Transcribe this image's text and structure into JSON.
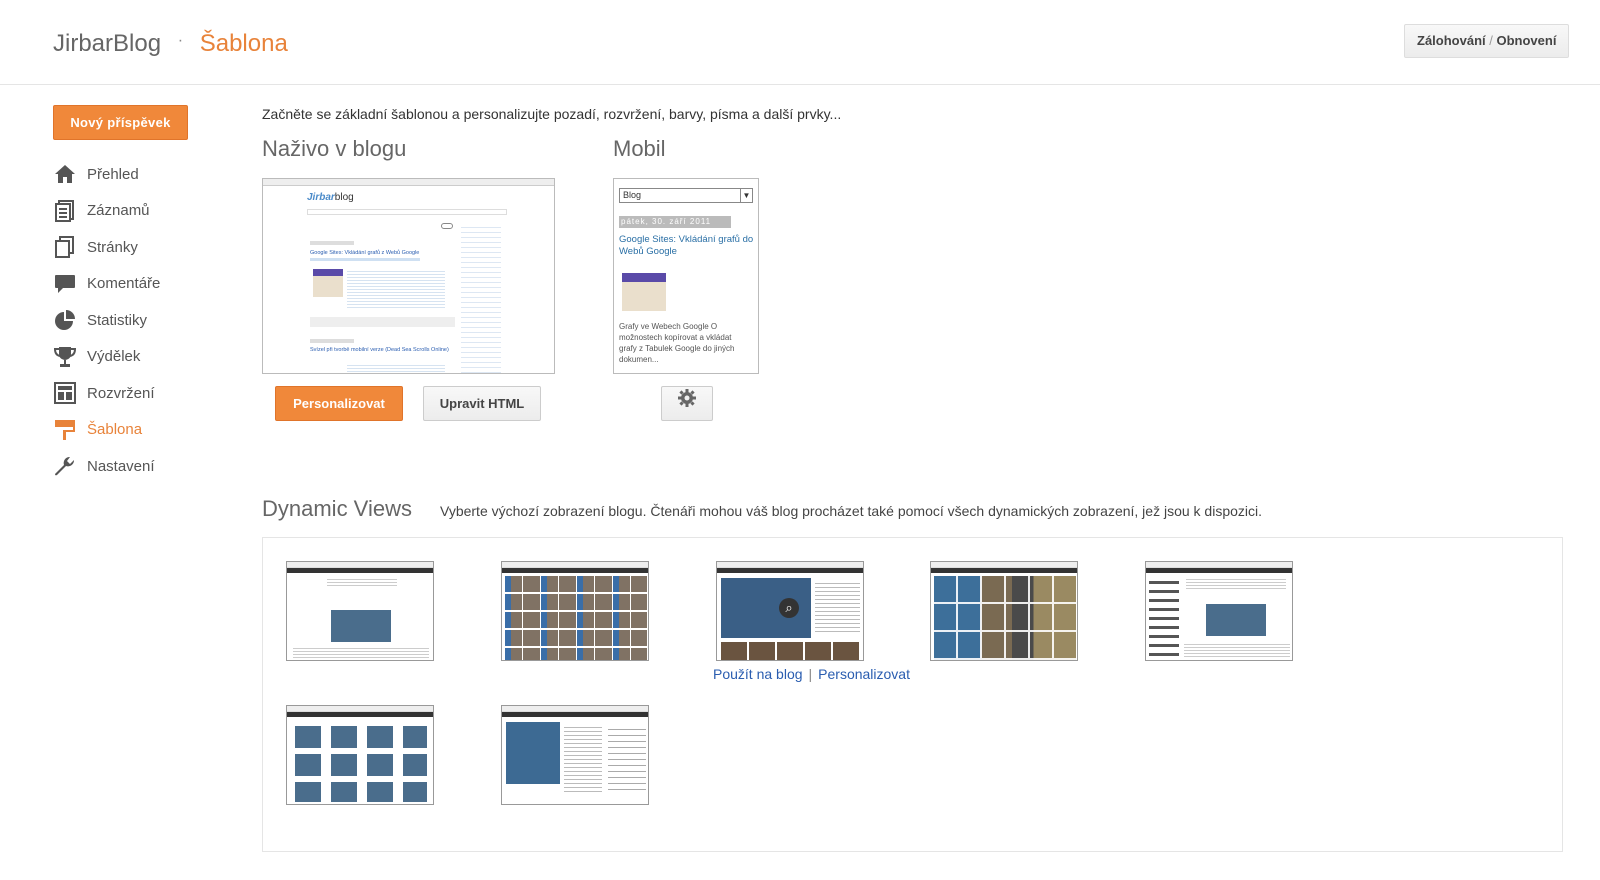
{
  "header": {
    "blog_name": "JirbarBlog",
    "separator": "·",
    "page_title": "Šablona",
    "backup_label_a": "Zálohování",
    "backup_sep": "/",
    "backup_label_b": "Obnovení"
  },
  "sidebar": {
    "new_post_label": "Nový příspěvek",
    "items": [
      {
        "label": "Přehled",
        "icon": "home-icon"
      },
      {
        "label": "Záznamů",
        "icon": "posts-icon"
      },
      {
        "label": "Stránky",
        "icon": "pages-icon"
      },
      {
        "label": "Komentáře",
        "icon": "comments-icon"
      },
      {
        "label": "Statistiky",
        "icon": "stats-icon"
      },
      {
        "label": "Výdělek",
        "icon": "trophy-icon"
      },
      {
        "label": "Rozvržení",
        "icon": "layout-icon"
      },
      {
        "label": "Šablona",
        "icon": "template-icon"
      },
      {
        "label": "Nastavení",
        "icon": "wrench-icon"
      }
    ],
    "active_index": 7
  },
  "main": {
    "intro": "Začněte se základní šablonou a personalizujte pozadí, rozvržení, barvy, písma a další prvky...",
    "live": {
      "title": "Naživo v blogu",
      "personalize_label": "Personalizovat",
      "edit_html_label": "Upravit HTML",
      "preview": {
        "logo_a": "Jirbar",
        "logo_b": "blog",
        "post1_title": "Google Sites: Vkládání grafů z Webů Google",
        "post2_title": "Svízel při tvorbě mobilní verze (Dead Sea Scrolls Online)"
      }
    },
    "mobile": {
      "title": "Mobil",
      "select_value": "Blog",
      "date": "pátek, 30. září 2011",
      "post_title": "Google Sites: Vkládání grafů do Webů Google",
      "post_excerpt": "Grafy ve Webech Google O možnostech kopírovat a vkládat grafy z Tabulek Google do jiných dokumen..."
    },
    "dynamic_views": {
      "title": "Dynamic Views",
      "description": "Vyberte výchozí zobrazení blogu. Čtenáři mohou váš blog procházet také pomocí všech dynamických zobrazení, jež jsou k dispozici.",
      "apply_label": "Použít na blog",
      "link_sep": "|",
      "personalize_label": "Personalizovat",
      "thumb_count": 7
    }
  },
  "colors": {
    "accent": "#f0883a",
    "link": "#2a5db0"
  }
}
